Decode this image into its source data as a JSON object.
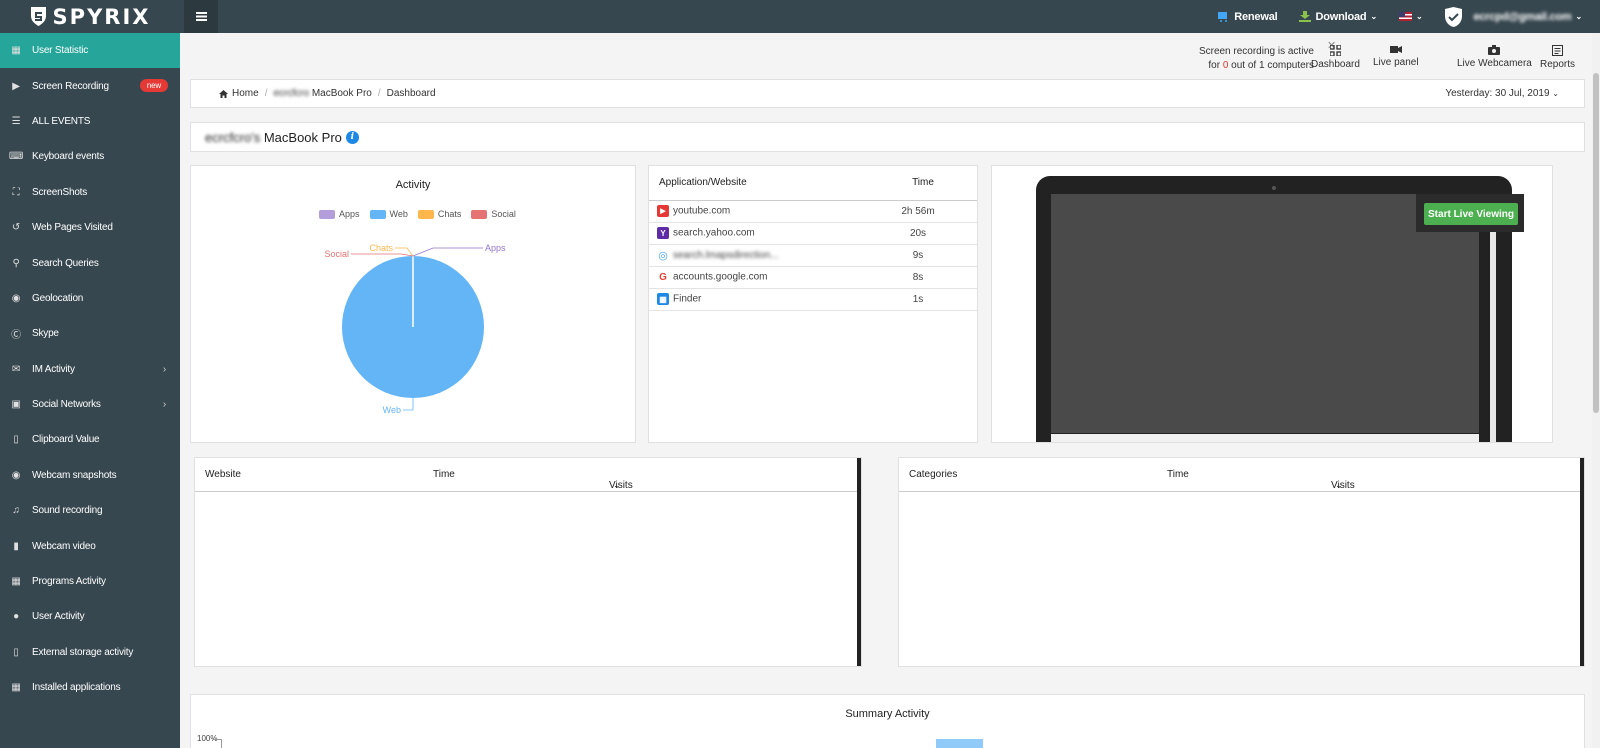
{
  "brand": {
    "name": "SPYRIX"
  },
  "topbar": {
    "renewal": "Renewal",
    "download": "Download",
    "user_email": "ecrcpd@gmail.com"
  },
  "sidebar": {
    "items": [
      {
        "label": "User Statistic",
        "icon": "grid-icon"
      },
      {
        "label": "Screen Recording",
        "icon": "play-icon",
        "badge": "new"
      },
      {
        "label": "ALL EVENTS",
        "icon": "list-icon"
      },
      {
        "label": "Keyboard events",
        "icon": "keyboard-icon"
      },
      {
        "label": "ScreenShots",
        "icon": "expand-icon"
      },
      {
        "label": "Web Pages Visited",
        "icon": "history-icon"
      },
      {
        "label": "Search Queries",
        "icon": "search-icon"
      },
      {
        "label": "Geolocation",
        "icon": "location-icon"
      },
      {
        "label": "Skype",
        "icon": "skype-icon"
      },
      {
        "label": "IM Activity",
        "icon": "chat-icon"
      },
      {
        "label": "Social Networks",
        "icon": "facebook-icon"
      },
      {
        "label": "Clipboard Value",
        "icon": "clipboard-icon"
      },
      {
        "label": "Webcam snapshots",
        "icon": "camera-icon"
      },
      {
        "label": "Sound recording",
        "icon": "microphone-icon"
      },
      {
        "label": "Webcam video",
        "icon": "video-icon"
      },
      {
        "label": "Programs Activity",
        "icon": "save-icon"
      },
      {
        "label": "User Activity",
        "icon": "user-icon"
      },
      {
        "label": "External storage activity",
        "icon": "usb-icon"
      },
      {
        "label": "Installed applications",
        "icon": "disk-icon"
      }
    ]
  },
  "recording_notice": {
    "line1": "Screen recording is active",
    "for": "for",
    "active_count": "0",
    "out_of": "out of",
    "total": "1",
    "computers": "computers"
  },
  "quick_nav": [
    "Dashboard",
    "Live panel",
    "Live Webcamera",
    "Reports"
  ],
  "breadcrumb": {
    "home": "Home",
    "user_prefix": "ecrcfcro",
    "device": "MacBook Pro",
    "current": "Dashboard",
    "date": "Yesterday: 30 Jul, 2019"
  },
  "device_header": {
    "user_prefix": "ecrcfcro's",
    "device": "MacBook Pro"
  },
  "activity": {
    "title": "Activity"
  },
  "chart_data": {
    "type": "pie",
    "title": "Activity",
    "categories": [
      "Apps",
      "Web",
      "Chats",
      "Social"
    ],
    "values": [
      0,
      100,
      0,
      0
    ],
    "colors": [
      "#b39ddb",
      "#64b5f6",
      "#ffb74d",
      "#e57373"
    ],
    "label_colors": [
      "#9575cd",
      "#64b5f6",
      "#ffb74d",
      "#e57373"
    ]
  },
  "apps_table": {
    "col_app": "Application/Website",
    "col_time": "Time",
    "rows": [
      {
        "name": "youtube.com",
        "time": "2h 56m",
        "icon": "youtube-icon"
      },
      {
        "name": "search.yahoo.com",
        "time": "20s",
        "icon": "yahoo-icon"
      },
      {
        "name": "search.lmapsdirection...",
        "time": "9s",
        "icon": "globe-icon"
      },
      {
        "name": "accounts.google.com",
        "time": "8s",
        "icon": "google-icon"
      },
      {
        "name": "Finder",
        "time": "1s",
        "icon": "finder-icon"
      }
    ]
  },
  "live_view": {
    "button": "Start Live Viewing"
  },
  "website_table": {
    "col1": "Website",
    "col2": "Time",
    "col3": "Visits"
  },
  "categories_table": {
    "col1": "Categories",
    "col2": "Time",
    "col3": "Visits"
  },
  "summary": {
    "title": "Summary Activity",
    "y_label": "100%"
  }
}
